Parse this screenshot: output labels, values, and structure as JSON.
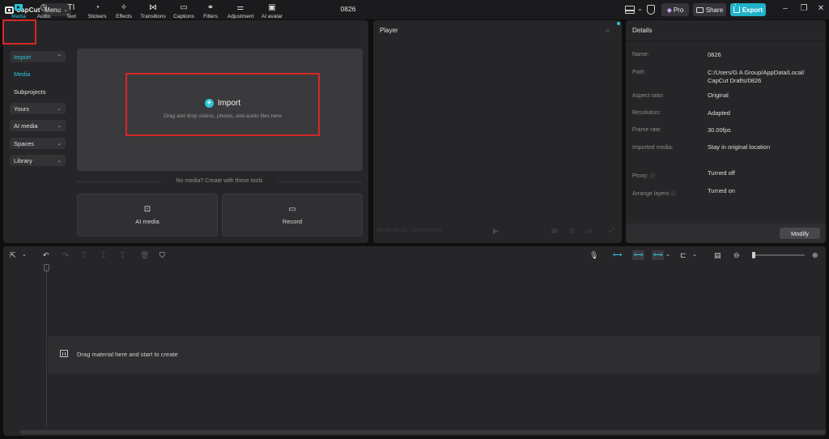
{
  "titlebar": {
    "app_name": "CapCut",
    "menu_label": "Menu",
    "project_title": "0826",
    "pro_label": "Pro",
    "share_label": "Share",
    "export_label": "Export"
  },
  "toolbar": {
    "tabs": [
      {
        "label": "Media",
        "icon": "media-icon",
        "active": true
      },
      {
        "label": "Audio",
        "icon": "audio-icon"
      },
      {
        "label": "Text",
        "icon": "text-icon"
      },
      {
        "label": "Stickers",
        "icon": "stickers-icon"
      },
      {
        "label": "Effects",
        "icon": "effects-icon"
      },
      {
        "label": "Transitions",
        "icon": "transitions-icon"
      },
      {
        "label": "Captions",
        "icon": "captions-icon"
      },
      {
        "label": "Filters",
        "icon": "filters-icon"
      },
      {
        "label": "Adjustment",
        "icon": "adjustment-icon"
      },
      {
        "label": "AI avatar",
        "icon": "ai-avatar-icon"
      }
    ]
  },
  "sidebar": {
    "items": [
      {
        "label": "Import",
        "expanded": true
      },
      {
        "label": "Media",
        "selected": true
      },
      {
        "label": "Subprojects"
      },
      {
        "label": "Yours"
      },
      {
        "label": "AI media"
      },
      {
        "label": "Spaces"
      },
      {
        "label": "Library"
      }
    ]
  },
  "import": {
    "label": "Import",
    "hint": "Drag and drop videos, photos, and audio files here",
    "no_media_text": "No media? Create with these tools",
    "cards": [
      {
        "label": "AI media",
        "icon": "ai-media-icon"
      },
      {
        "label": "Record",
        "icon": "record-icon"
      }
    ]
  },
  "player": {
    "title": "Player",
    "timecode": "00:00:00:00 / 00:00:00:00"
  },
  "details": {
    "title": "Details",
    "rows": [
      {
        "key": "Name:",
        "value": "0826"
      },
      {
        "key": "Path:",
        "value": "C:/Users/G A Group/AppData/Local/\nCapCut Drafts/0826"
      },
      {
        "key": "Aspect ratio:",
        "value": "Original"
      },
      {
        "key": "Resolution:",
        "value": "Adapted"
      },
      {
        "key": "Frame rate:",
        "value": "30.00fps"
      },
      {
        "key": "Imported media:",
        "value": "Stay in original location"
      },
      {
        "key": "Proxy:",
        "value": "Turned off"
      },
      {
        "key": "Arrange layers",
        "value": "Turned on"
      }
    ],
    "modify_label": "Modify"
  },
  "timeline": {
    "track_hint": "Drag material here and start to create"
  },
  "colors": {
    "accent": "#2bc4d8",
    "export": "#20b2c9",
    "highlight": "#d62828",
    "panel": "#262628",
    "background": "#0f0f10"
  }
}
